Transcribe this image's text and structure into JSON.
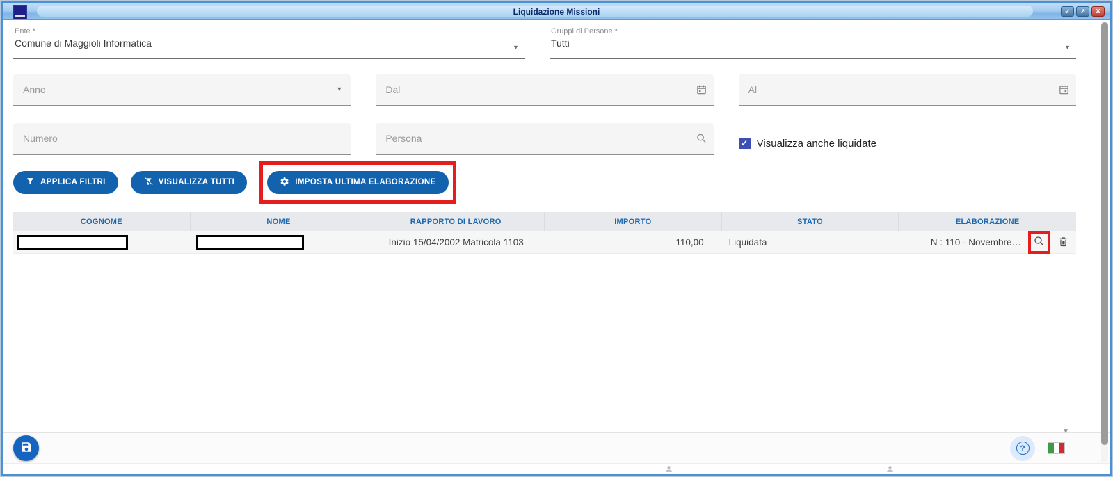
{
  "window": {
    "title": "Liquidazione Missioni",
    "controls": {
      "minimize_glyph": "↙",
      "maximize_glyph": "↗",
      "close_glyph": "✕"
    }
  },
  "icons": {
    "dropdown_caret": "▼",
    "check": "✓"
  },
  "filters": {
    "ente": {
      "label": "Ente *",
      "value": "Comune di Maggioli Informatica"
    },
    "gruppi_persone": {
      "label": "Gruppi di Persone *",
      "value": "Tutti"
    },
    "anno": {
      "placeholder": "Anno"
    },
    "dal": {
      "placeholder": "Dal"
    },
    "al": {
      "placeholder": "Al"
    },
    "numero": {
      "placeholder": "Numero"
    },
    "persona": {
      "placeholder": "Persona"
    },
    "visualizza_liquidate": {
      "label": "Visualizza anche liquidate",
      "checked": true
    }
  },
  "toolbar": {
    "applica_filtri_label": "APPLICA FILTRI",
    "visualizza_tutti_label": "VISUALIZZA TUTTI",
    "imposta_ultima_label": "IMPOSTA ULTIMA ELABORAZIONE"
  },
  "table": {
    "headers": [
      "COGNOME",
      "NOME",
      "RAPPORTO DI LAVORO",
      "IMPORTO",
      "STATO",
      "ELABORAZIONE"
    ],
    "rows": [
      {
        "cognome_redacted": true,
        "nome_redacted": true,
        "rapporto_di_lavoro": "Inizio 15/04/2002 Matricola 1103",
        "importo": "110,00",
        "stato": "Liquidata",
        "elaborazione": "N : 110 - Novembre…"
      }
    ]
  },
  "footer": {
    "help_glyph": "?"
  },
  "colors": {
    "accent_blue": "#1262ad",
    "annotation_red": "#e51d1c",
    "checkbox_indigo": "#3d4eb5",
    "table_header_text": "#1a67b0",
    "titlebar_text": "#0b2a66",
    "flag_green": "#3d9b43",
    "flag_red": "#ce2b37"
  }
}
